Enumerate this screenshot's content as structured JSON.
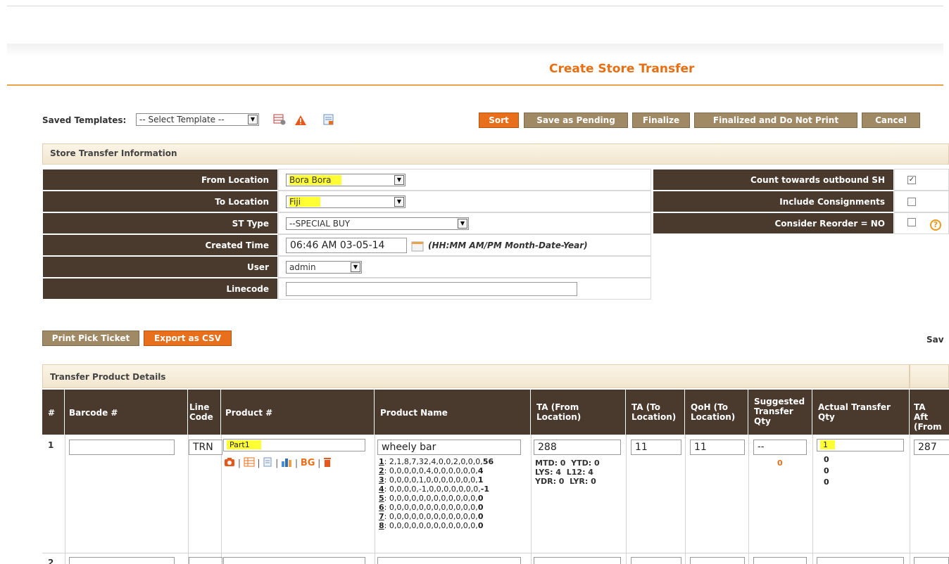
{
  "page": {
    "title": "Create Store Transfer"
  },
  "toolbar": {
    "saved_templates_label": "Saved Templates:",
    "template_select_value": "-- Select Template --",
    "buttons": {
      "sort": "Sort",
      "save_pending": "Save as Pending",
      "finalize": "Finalize",
      "finalize_no_print": "Finalized and Do Not Print",
      "cancel": "Cancel"
    }
  },
  "store_info": {
    "section_title": "Store Transfer Information",
    "from_location": {
      "label": "From Location",
      "value": "Bora Bora"
    },
    "to_location": {
      "label": "To Location",
      "value": "Fiji"
    },
    "st_type": {
      "label": "ST Type",
      "value": "--SPECIAL BUY"
    },
    "created_time": {
      "label": "Created Time",
      "value": "06:46 AM 03-05-14",
      "hint": "(HH:MM AM/PM Month-Date-Year)"
    },
    "user": {
      "label": "User",
      "value": "admin"
    },
    "linecode": {
      "label": "Linecode",
      "value": ""
    },
    "options": {
      "count_outbound": {
        "label": "Count towards outbound SH",
        "checked": "✓"
      },
      "include_consignments": {
        "label": "Include Consignments",
        "checked": ""
      },
      "consider_reorder": {
        "label": "Consider Reorder = NO",
        "checked": ""
      }
    }
  },
  "actions": {
    "print_pick_ticket": "Print Pick Ticket",
    "export_csv": "Export as CSV",
    "right_cut": "Sav"
  },
  "transfer_details": {
    "section_title": "Transfer Product Details",
    "columns": {
      "num": "#",
      "barcode": "Barcode #",
      "line_code": "Line Code",
      "product": "Product #",
      "product_name": "Product Name",
      "ta_from": "TA (From Location)",
      "ta_to": "TA (To Location)",
      "qoh_to": "QoH (To Location)",
      "suggested": "Suggested Transfer Qty",
      "actual": "Actual Transfer Qty",
      "ta_after": "TA Aft (From"
    },
    "rows": [
      {
        "num": "1",
        "barcode": "",
        "line_code": "TRN",
        "product": "Part1",
        "product_name": "wheely bar",
        "history": [
          {
            "n": "1",
            "vals": ": 2,1,8,7,32,4,0,0,2,0,0,0,",
            "last": "56"
          },
          {
            "n": "2",
            "vals": ": 0,0,0,0,0,4,0,0,0,0,0,0,",
            "last": "4"
          },
          {
            "n": "3",
            "vals": ": 0,0,0,0,1,0,0,0,0,0,0,0,",
            "last": "1"
          },
          {
            "n": "4",
            "vals": ": 0,0,0,0,-1,0,0,0,0,0,0,0,",
            "last": "-1"
          },
          {
            "n": "5",
            "vals": ": 0,0,0,0,0,0,0,0,0,0,0,0,",
            "last": "0"
          },
          {
            "n": "6",
            "vals": ": 0,0,0,0,0,0,0,0,0,0,0,0,",
            "last": "0"
          },
          {
            "n": "7",
            "vals": ": 0,0,0,0,0,0,0,0,0,0,0,0,",
            "last": "0"
          },
          {
            "n": "8",
            "vals": ": 0,0,0,0,0,0,0,0,0,0,0,0,",
            "last": "0"
          }
        ],
        "ta_from": "288",
        "ta_stats": {
          "mtd": "MTD: 0",
          "ytd": "YTD: 0",
          "lys": "LYS: 4",
          "l12": "L12: 4",
          "ydr": "YDR: 0",
          "lyr": "LYR: 0"
        },
        "ta_to": "11",
        "qoh_to": "11",
        "suggested": "--",
        "suggested_sub": "0",
        "actual": "1",
        "actual_sub": [
          "0",
          "0",
          "0"
        ],
        "ta_after": "287"
      },
      {
        "num": "2"
      }
    ]
  },
  "colors": {
    "accent": "#e8701c",
    "header_dark": "#4a3a2e",
    "tan_button": "#a08a66",
    "highlight": "#ffff33"
  }
}
